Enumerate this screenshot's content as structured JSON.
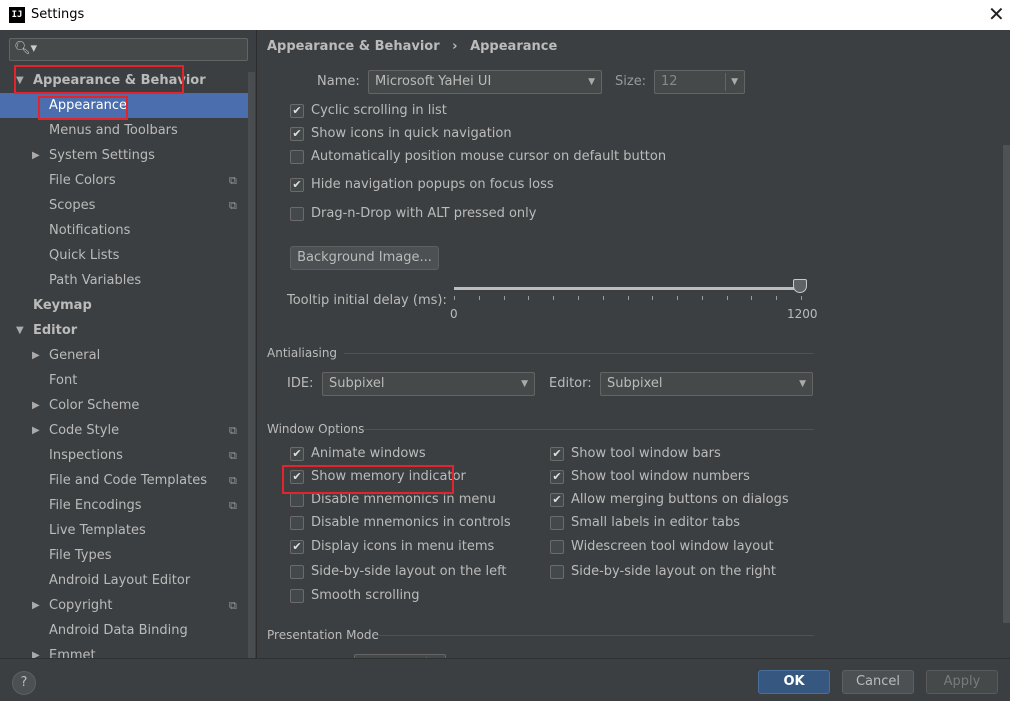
{
  "window": {
    "title": "Settings",
    "app_icon_text": "IJ",
    "close_glyph": "✕"
  },
  "sidebar": {
    "search_icon": "search-icon",
    "search_placeholder": "",
    "items": [
      {
        "label": "Appearance & Behavior",
        "level": 0,
        "expanded": true,
        "bold": true
      },
      {
        "label": "Appearance",
        "level": 1,
        "selected": true
      },
      {
        "label": "Menus and Toolbars",
        "level": 1
      },
      {
        "label": "System Settings",
        "level": 1,
        "collapsed": true
      },
      {
        "label": "File Colors",
        "level": 1,
        "project_icon": true
      },
      {
        "label": "Scopes",
        "level": 1,
        "project_icon": true
      },
      {
        "label": "Notifications",
        "level": 1
      },
      {
        "label": "Quick Lists",
        "level": 1
      },
      {
        "label": "Path Variables",
        "level": 1
      },
      {
        "label": "Keymap",
        "level": 0,
        "bold": true
      },
      {
        "label": "Editor",
        "level": 0,
        "expanded": true,
        "bold": true
      },
      {
        "label": "General",
        "level": 1,
        "collapsed": true
      },
      {
        "label": "Font",
        "level": 1
      },
      {
        "label": "Color Scheme",
        "level": 1,
        "collapsed": true
      },
      {
        "label": "Code Style",
        "level": 1,
        "collapsed": true,
        "project_icon": true
      },
      {
        "label": "Inspections",
        "level": 1,
        "project_icon": true
      },
      {
        "label": "File and Code Templates",
        "level": 1,
        "project_icon": true
      },
      {
        "label": "File Encodings",
        "level": 1,
        "project_icon": true
      },
      {
        "label": "Live Templates",
        "level": 1
      },
      {
        "label": "File Types",
        "level": 1
      },
      {
        "label": "Android Layout Editor",
        "level": 1
      },
      {
        "label": "Copyright",
        "level": 1,
        "collapsed": true,
        "project_icon": true
      },
      {
        "label": "Android Data Binding",
        "level": 1
      },
      {
        "label": "Emmet",
        "level": 1,
        "collapsed": true
      }
    ]
  },
  "breadcrumb": {
    "parent": "Appearance & Behavior",
    "separator": "›",
    "current": "Appearance"
  },
  "font": {
    "name_label": "Name:",
    "name_value": "Microsoft YaHei UI",
    "size_label": "Size:",
    "size_value": "12"
  },
  "general_options": [
    {
      "label": "Cyclic scrolling in list",
      "checked": true
    },
    {
      "label": "Show icons in quick navigation",
      "checked": true
    },
    {
      "label": "Automatically position mouse cursor on default button",
      "checked": false
    },
    {
      "label": "Hide navigation popups on focus loss",
      "checked": true
    },
    {
      "label": "Drag-n-Drop with ALT pressed only",
      "checked": false
    }
  ],
  "background_image_button": "Background Image...",
  "tooltip": {
    "label": "Tooltip initial delay (ms):",
    "min": "0",
    "max": "1200",
    "value": 1200
  },
  "antialiasing": {
    "title": "Antialiasing",
    "ide_label": "IDE:",
    "ide_value": "Subpixel",
    "editor_label": "Editor:",
    "editor_value": "Subpixel"
  },
  "window_options": {
    "title": "Window Options",
    "left": [
      {
        "label": "Animate windows",
        "checked": true
      },
      {
        "label": "Show memory indicator",
        "checked": true
      },
      {
        "label": "Disable mnemonics in menu",
        "checked": false
      },
      {
        "label": "Disable mnemonics in controls",
        "checked": false
      },
      {
        "label": "Display icons in menu items",
        "checked": true
      },
      {
        "label": "Side-by-side layout on the left",
        "checked": false
      },
      {
        "label": "Smooth scrolling",
        "checked": false
      }
    ],
    "right": [
      {
        "label": "Show tool window bars",
        "checked": true
      },
      {
        "label": "Show tool window numbers",
        "checked": true
      },
      {
        "label": "Allow merging buttons on dialogs",
        "checked": true
      },
      {
        "label": "Small labels in editor tabs",
        "checked": false
      },
      {
        "label": "Widescreen tool window layout",
        "checked": false
      },
      {
        "label": "Side-by-side layout on the right",
        "checked": false
      }
    ]
  },
  "presentation_mode": {
    "title": "Presentation Mode"
  },
  "footer": {
    "help": "?",
    "ok": "OK",
    "cancel": "Cancel",
    "apply": "Apply"
  },
  "colors": {
    "background": "#3c3f41",
    "selection": "#4b6eaf",
    "ok_button": "#365880",
    "highlight": "#e5232a"
  }
}
